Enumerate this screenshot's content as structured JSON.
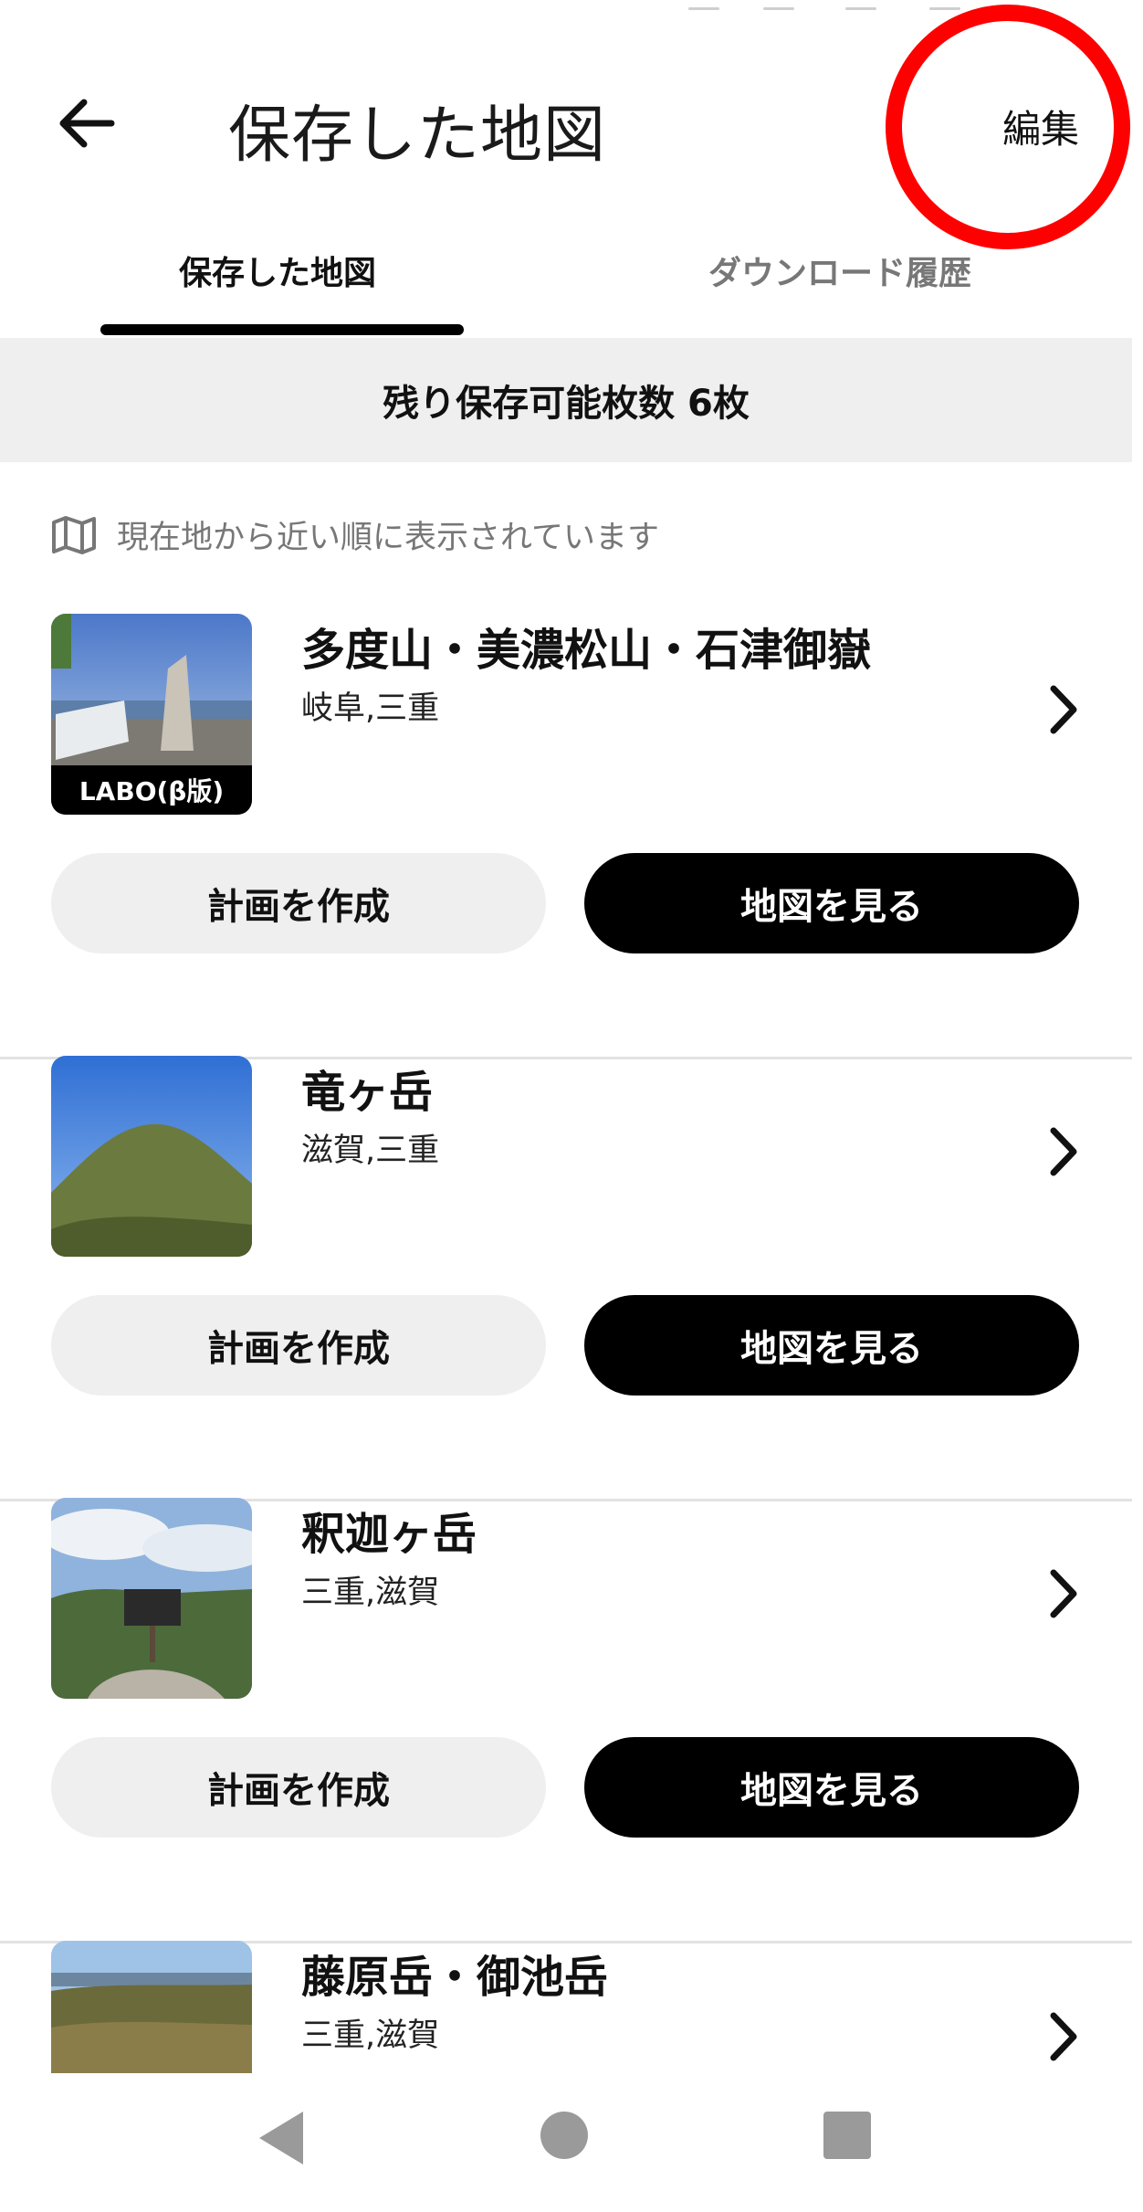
{
  "header": {
    "title": "保存した地図",
    "edit_label": "編集"
  },
  "tabs": [
    {
      "label": "保存した地図",
      "active": true
    },
    {
      "label": "ダウンロード履歴",
      "active": false
    }
  ],
  "banner": "残り保存可能枚数 6枚",
  "hint": {
    "icon": "map-icon",
    "text": "現在地から近い順に表示されています"
  },
  "cards": [
    {
      "name": "多度山・美濃松山・石津御嶽",
      "region": "岐阜,三重",
      "badge": "LABO(β版)",
      "plan_label": "計画を作成",
      "map_label": "地図を見る"
    },
    {
      "name": "竜ヶ岳",
      "region": "滋賀,三重",
      "plan_label": "計画を作成",
      "map_label": "地図を見る"
    },
    {
      "name": "釈迦ヶ岳",
      "region": "三重,滋賀",
      "plan_label": "計画を作成",
      "map_label": "地図を見る"
    },
    {
      "name": "藤原岳・御池岳",
      "region": "三重,滋賀"
    }
  ],
  "nav": {
    "back": "back-triangle-icon",
    "home": "home-circle-icon",
    "recents": "recents-square-icon"
  },
  "colors": {
    "accent": "#000000",
    "highlight_ring": "#ff0000",
    "banner_bg": "#efefef"
  }
}
